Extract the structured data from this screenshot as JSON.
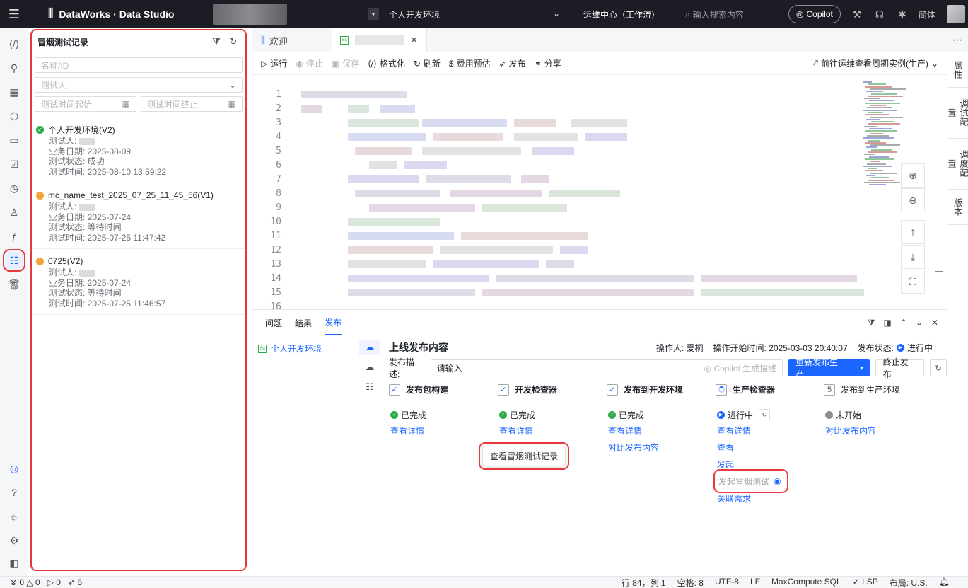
{
  "topbar": {
    "brand": "DataWorks · Data Studio",
    "env": "个人开发环境",
    "ops": "运维中心（工作流）",
    "search_placeholder": "输入搜索内容",
    "copilot": "Copilot",
    "lang": "简体"
  },
  "sidepanel": {
    "title": "冒烟测试记录",
    "name_placeholder": "名称/ID",
    "tester_placeholder": "测试人",
    "start_placeholder": "测试时间起始",
    "end_placeholder": "测试时间终止",
    "records": [
      {
        "title": "个人开发环境(V2)",
        "status_color": "#2bab48",
        "tester": "测试人:",
        "biz_date": "业务日期: 2025-08-09",
        "state": "测试状态: 成功",
        "time": "测试时间: 2025-08-10 13:59:22"
      },
      {
        "title": "mc_name_test_2025_07_25_11_45_56(V1)",
        "status_color": "#f2a33a",
        "tester": "测试人:",
        "biz_date": "业务日期: 2025-07-24",
        "state": "测试状态: 等待时间",
        "time": "测试时间: 2025-07-25 11:47:42"
      },
      {
        "title": "0725(V2)",
        "status_color": "#f2a33a",
        "tester": "测试人:",
        "biz_date": "业务日期: 2025-07-24",
        "state": "测试状态: 等待时间",
        "time": "测试时间: 2025-07-25 11:46:57"
      }
    ]
  },
  "tabs": {
    "welcome": "欢迎",
    "sql_badge": "Sq"
  },
  "toolbar": {
    "run": "运行",
    "stop": "停止",
    "save": "保存",
    "format": "格式化",
    "refresh": "刷新",
    "cost": "费用预估",
    "publish": "发布",
    "share": "分享",
    "goto_ops": "前往运维查看周期实例(生产)"
  },
  "rightbar": {
    "props": "属性",
    "debug": "调试配置",
    "schedule": "调度配置",
    "version": "版本"
  },
  "code": {
    "line_numbers": [
      "1",
      "2",
      "3",
      "4",
      "5",
      "6",
      "7",
      "8",
      "9",
      "10",
      "11",
      "12",
      "13",
      "14",
      "15",
      "16"
    ]
  },
  "bottom": {
    "tabs": [
      "问题",
      "结果",
      "发布"
    ],
    "env_item": "个人开发环境",
    "pub_title": "上线发布内容",
    "operator": "操作人: 爱桐",
    "op_start": "操作开始时间: 2025-03-03 20:40:07",
    "pub_status_label": "发布状态:",
    "pub_status": "进行中",
    "desc_label": "发布描述:",
    "desc_value": "请输入",
    "desc_copilot": "Copilot 生成描述",
    "republish": "重新发布生产",
    "stop_publish": "终止发布",
    "steps": [
      {
        "label": "发布包构建",
        "status": "已完成",
        "links": [
          "查看详情"
        ]
      },
      {
        "label": "开发检查器",
        "status": "已完成",
        "links": [
          "查看详情"
        ]
      },
      {
        "label": "发布到开发环境",
        "status": "已完成",
        "links": [
          "查看详情",
          "对比发布内容"
        ]
      },
      {
        "label": "生产检查器",
        "status": "进行中",
        "links": [
          "查看详情",
          "查看",
          "发起"
        ]
      },
      {
        "label": "发布到生产环境",
        "status": "未开始",
        "links": [
          "对比发布内容"
        ]
      }
    ],
    "step5_num": "5",
    "tooltip": "查看冒烟测试记录",
    "start_smoke": "发起冒烟测试",
    "link_req": "关联需求"
  },
  "statusbar": {
    "errors": "0",
    "warnings": "0",
    "runs": "0",
    "sends": "6",
    "position": "行 84，列 1",
    "spaces": "空格: 8",
    "encoding": "UTF-8",
    "eol": "LF",
    "lang": "MaxCompute SQL",
    "lsp": "LSP",
    "layout": "布局: U.S."
  }
}
